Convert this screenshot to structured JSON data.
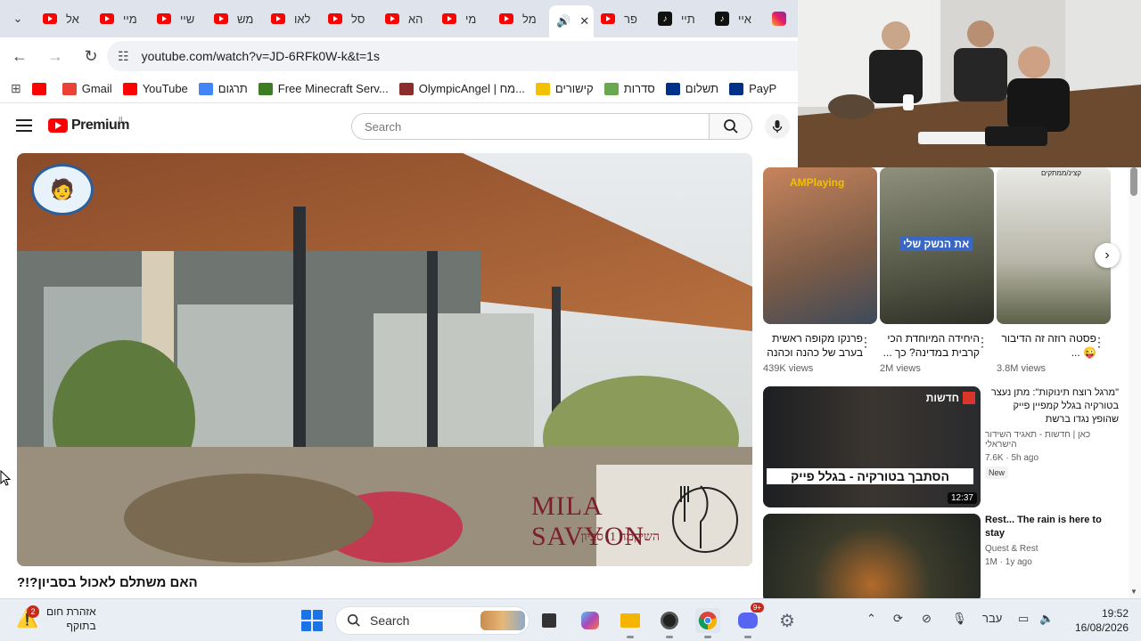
{
  "browser": {
    "tabs": [
      {
        "label": "אל",
        "icon": "youtube"
      },
      {
        "label": "מיי",
        "icon": "youtube"
      },
      {
        "label": "שיי",
        "icon": "youtube"
      },
      {
        "label": "מש",
        "icon": "youtube"
      },
      {
        "label": "לאו",
        "icon": "youtube"
      },
      {
        "label": "סל",
        "icon": "youtube"
      },
      {
        "label": "הא",
        "icon": "youtube"
      },
      {
        "label": "מי",
        "icon": "youtube"
      },
      {
        "label": "מל",
        "icon": "youtube"
      }
    ],
    "tabs_after": [
      {
        "label": "פר",
        "icon": "youtube"
      },
      {
        "label": "תיי",
        "icon": "tiktok"
      },
      {
        "label": "איי",
        "icon": "tiktok"
      }
    ],
    "url": "youtube.com/watch?v=JD-6RFk0W-k&t=1s",
    "bookmarks": [
      {
        "label": "",
        "icon": "youtube",
        "color": "#ff0000"
      },
      {
        "label": "Gmail",
        "icon": "gmail",
        "color": "#ea4335"
      },
      {
        "label": "YouTube",
        "icon": "youtube",
        "color": "#ff0000"
      },
      {
        "label": "תרגום",
        "icon": "translate",
        "color": "#4285f4"
      },
      {
        "label": "Free Minecraft Serv...",
        "icon": "minecraft",
        "color": "#3b7d23"
      },
      {
        "label": "OlympicAngel | מח...",
        "icon": "avatar",
        "color": "#8b2d2d"
      },
      {
        "label": "קישורים",
        "icon": "star",
        "color": "#f2c200"
      },
      {
        "label": "סדרות",
        "icon": "tv",
        "color": "#6aa84f"
      },
      {
        "label": "תשלום",
        "icon": "paypal",
        "color": "#003087"
      },
      {
        "label": "PayP",
        "icon": "paypal",
        "color": "#003087"
      }
    ]
  },
  "youtube": {
    "logo_text": "Premium",
    "country": "IL",
    "search_placeholder": "Search"
  },
  "video": {
    "title": "האם משתלם לאכול בסביון?!?",
    "watermark_title": "MILA SAVYON",
    "watermark_subtitle": "השיקמה 1, סביון"
  },
  "shorts": [
    {
      "title": "פרנקו מקופה ראשית בערב של כהנה וכהנה",
      "views": "439K views",
      "overlay": "AMPlaying"
    },
    {
      "title": "היחידה המיוחדת הכי קרבית במדינה? כך ...",
      "views": "2M views",
      "overlay": "את הנשק שלי"
    },
    {
      "title": "פסטה רוזה זה הדיבור 😜 ...",
      "views": "3.8M views",
      "overlay": "קצינ/ממתקים"
    }
  ],
  "recommended": [
    {
      "title": "\"מרגל רוצח תינוקות\": מתן נעצר בטורקיה בגלל קמפיין פייק שהופץ נגדו ברשת",
      "channel": "כאן | חדשות - תאגיד השידור הישראלי",
      "meta": "7.6K · 5h ago",
      "badge": "New",
      "duration": "12:37",
      "thumb_text": "הסתבך בטורקיה - בגלל פייק",
      "thumb_tag": "חדשות",
      "rtl": true
    },
    {
      "title": "Rest... The rain is here to stay",
      "channel": "Quest & Rest",
      "meta": "1M · 1y ago",
      "badge": "",
      "duration": "",
      "thumb_text": "",
      "thumb_tag": "",
      "rtl": false
    }
  ],
  "taskbar": {
    "weather_title": "אזהרת חום",
    "weather_sub": "בתוקף",
    "weather_badge": "2",
    "search_label": "Search",
    "discord_badge": "9+",
    "language": "עבר",
    "time": "19:52",
    "date": "16/08/2026"
  }
}
